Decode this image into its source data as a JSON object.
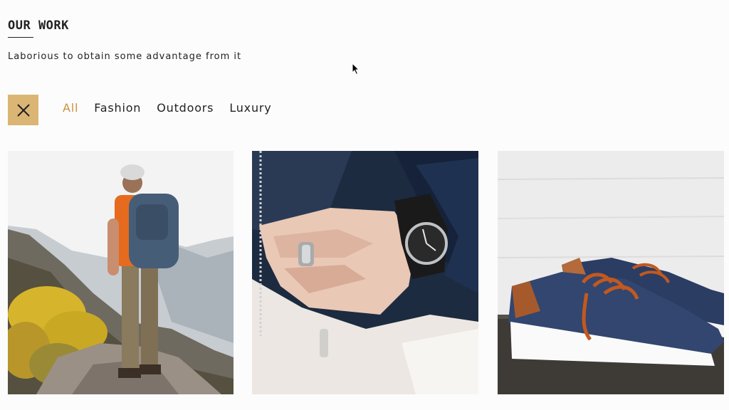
{
  "section": {
    "title": "OUR WORK",
    "subtitle": "Laborious to obtain some advantage from it"
  },
  "toolbar": {
    "close_icon": "close-icon",
    "accent_color": "#dbb574"
  },
  "filters": [
    {
      "label": "All",
      "active": true
    },
    {
      "label": "Fashion",
      "active": false
    },
    {
      "label": "Outdoors",
      "active": false
    },
    {
      "label": "Luxury",
      "active": false
    }
  ],
  "gallery": [
    {
      "subject": "hiker-on-mountain"
    },
    {
      "subject": "hand-with-ring-and-watch"
    },
    {
      "subject": "blue-canvas-sneakers"
    }
  ]
}
